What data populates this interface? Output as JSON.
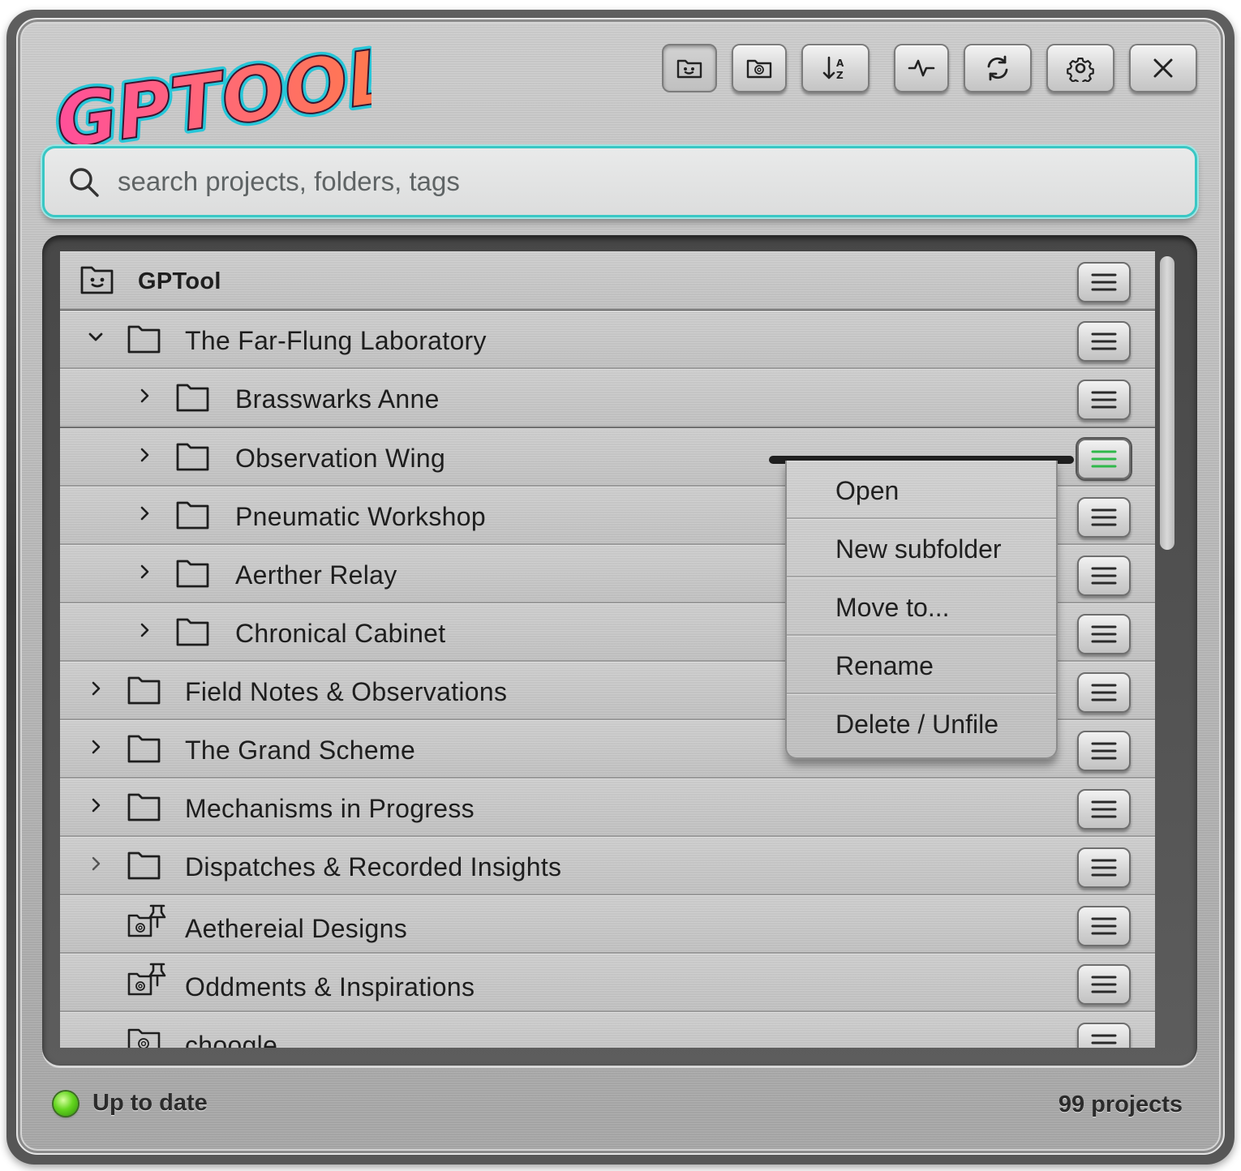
{
  "app": {
    "logo_text": "GPTOOL"
  },
  "toolbar": {
    "buttons": [
      {
        "icon": "folder-smile-icon"
      },
      {
        "icon": "folder-gpt-icon"
      },
      {
        "icon": "sort-az-icon"
      },
      {
        "icon": "activity-icon"
      },
      {
        "icon": "refresh-icon"
      },
      {
        "icon": "gear-icon"
      },
      {
        "icon": "close-icon"
      }
    ]
  },
  "search": {
    "placeholder": "search projects, folders, tags",
    "value": ""
  },
  "tree": {
    "root": {
      "label": "GPTool",
      "icon": "folder-smile-icon"
    },
    "rows": [
      {
        "label": "The Far-Flung Laboratory",
        "expanded": true,
        "level": 0,
        "icon": "folder-icon"
      },
      {
        "label": "Brasswarks Anne",
        "expanded": false,
        "level": 1,
        "icon": "folder-icon"
      },
      {
        "label": "Observation Wing",
        "expanded": false,
        "level": 1,
        "icon": "folder-icon"
      },
      {
        "label": "Pneumatic Workshop",
        "expanded": false,
        "level": 1,
        "icon": "folder-icon"
      },
      {
        "label": "Aerther Relay",
        "expanded": false,
        "level": 1,
        "icon": "folder-icon"
      },
      {
        "label": "Chronical Cabinet",
        "expanded": false,
        "level": 1,
        "icon": "folder-icon"
      },
      {
        "label": "Field Notes & Observations",
        "expanded": false,
        "level": 0,
        "icon": "folder-icon"
      },
      {
        "label": "The Grand Scheme",
        "expanded": false,
        "level": 0,
        "icon": "folder-icon"
      },
      {
        "label": "Mechanisms in Progress",
        "expanded": false,
        "level": 0,
        "icon": "folder-icon"
      },
      {
        "label": "Dispatches & Recorded Insights",
        "expanded": false,
        "level": 0,
        "icon": "folder-icon"
      },
      {
        "label": "Aethereial Designs",
        "level": 0,
        "icon": "pinned-gpt-icon"
      },
      {
        "label": "Oddments & Inspirations",
        "level": 0,
        "icon": "pinned-gpt-icon"
      },
      {
        "label": "choogle",
        "level": 0,
        "icon": "gpt-project-icon"
      }
    ]
  },
  "context_menu": {
    "items": [
      "Open",
      "New subfolder",
      "Move to...",
      "Rename",
      "Delete / Unfile"
    ]
  },
  "status": {
    "text": "Up to date",
    "count_text": "99 projects"
  },
  "colors": {
    "accent": "#39c7c4",
    "active_menu": "#2fb84a",
    "led": "#64d61f"
  }
}
